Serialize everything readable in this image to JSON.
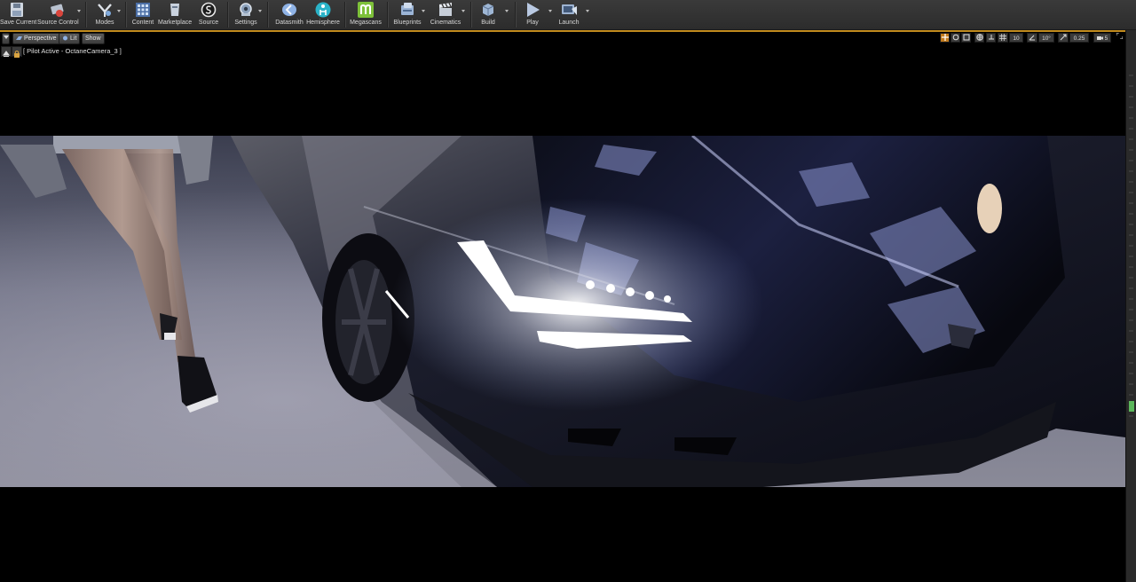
{
  "toolbar": {
    "buttons": [
      {
        "label": "Save Current",
        "icon": "save-icon"
      },
      {
        "label": "Source Control",
        "icon": "source-control-icon"
      },
      {
        "label": "Modes",
        "icon": "modes-icon"
      },
      {
        "label": "Content",
        "icon": "content-icon"
      },
      {
        "label": "Marketplace",
        "icon": "marketplace-icon"
      },
      {
        "label": "Source",
        "icon": "source-icon"
      },
      {
        "label": "Settings",
        "icon": "settings-icon"
      },
      {
        "label": "Datasmith",
        "icon": "datasmith-icon"
      },
      {
        "label": "Hemisphere",
        "icon": "hemisphere-icon"
      },
      {
        "label": "Megascans",
        "icon": "megascans-icon"
      },
      {
        "label": "Blueprints",
        "icon": "blueprints-icon"
      },
      {
        "label": "Cinematics",
        "icon": "cinematics-icon"
      },
      {
        "label": "Build",
        "icon": "build-icon"
      },
      {
        "label": "Play",
        "icon": "play-icon"
      },
      {
        "label": "Launch",
        "icon": "launch-icon"
      }
    ]
  },
  "viewport": {
    "perspective_label": "Perspective",
    "lit_label": "Lit",
    "show_label": "Show",
    "grid_snap_value": "10",
    "rotation_snap_value": "10°",
    "scale_snap_value": "0.25",
    "camera_speed_value": "5",
    "pilot_text": "[ Pilot Active - OctaneCamera_3 ]"
  },
  "colors": {
    "accent": "#c08a1d",
    "toolbar_bg": "#333333",
    "megascans_green": "#7ec13a",
    "viewport_bg": "#000000"
  }
}
